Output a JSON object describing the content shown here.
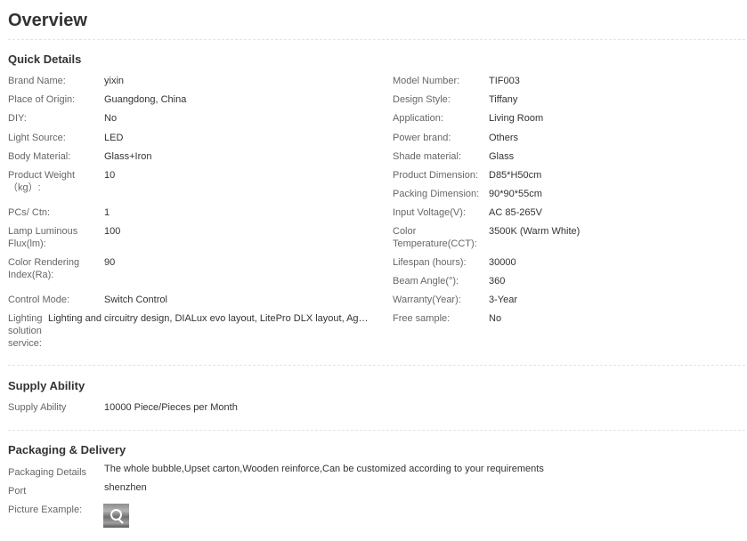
{
  "page_title": "Overview",
  "quick_details": {
    "title": "Quick Details",
    "left": [
      {
        "label": "Brand Name:",
        "value": "yixin"
      },
      {
        "label": "Place of Origin:",
        "value": "Guangdong, China"
      },
      {
        "label": "DIY:",
        "value": "No"
      },
      {
        "label": "Light Source:",
        "value": "LED"
      },
      {
        "label": "Body Material:",
        "value": "Glass+Iron"
      },
      {
        "label": "Product Weight（kg）:",
        "value": "10"
      },
      {
        "label": "PCs/ Ctn:",
        "value": "1"
      },
      {
        "label": "Lamp Luminous Flux(lm):",
        "value": "100"
      },
      {
        "label": "Color Rendering Index(Ra):",
        "value": "90"
      },
      {
        "label": "Control Mode:",
        "value": "Switch Control"
      },
      {
        "label": "Lighting solution service:",
        "value": "Lighting and circuitry design, DIALux evo layout, LitePro DLX layout, Agi32..."
      }
    ],
    "right": [
      {
        "label": "Model Number:",
        "value": "TIF003"
      },
      {
        "label": "Design Style:",
        "value": "Tiffany"
      },
      {
        "label": "Application:",
        "value": "Living Room"
      },
      {
        "label": "Power brand:",
        "value": "Others"
      },
      {
        "label": "Shade material:",
        "value": "Glass"
      },
      {
        "label": "Product Dimension:",
        "value": "D85*H50cm"
      },
      {
        "label": "Packing Dimension:",
        "value": "90*90*55cm"
      },
      {
        "label": "Input Voltage(V):",
        "value": "AC 85-265V"
      },
      {
        "label": "Color Temperature(CCT):",
        "value": "3500K (Warm White)"
      },
      {
        "label": "Lifespan (hours):",
        "value": "30000"
      },
      {
        "label": "Beam Angle(°):",
        "value": "360"
      },
      {
        "label": "Warranty(Year):",
        "value": "3-Year"
      },
      {
        "label": "Free sample:",
        "value": "No"
      }
    ]
  },
  "supply_ability": {
    "title": "Supply Ability",
    "label": "Supply Ability",
    "value": "10000 Piece/Pieces per Month"
  },
  "packaging": {
    "title": "Packaging & Delivery",
    "details_label": "Packaging Details",
    "details_value": "The whole bubble,Upset carton,Wooden reinforce,Can be customized according to your requirements",
    "port_label": "Port",
    "port_value": "shenzhen",
    "picture_label": "Picture Example:",
    "picture_icon": "zoom-in-icon"
  }
}
